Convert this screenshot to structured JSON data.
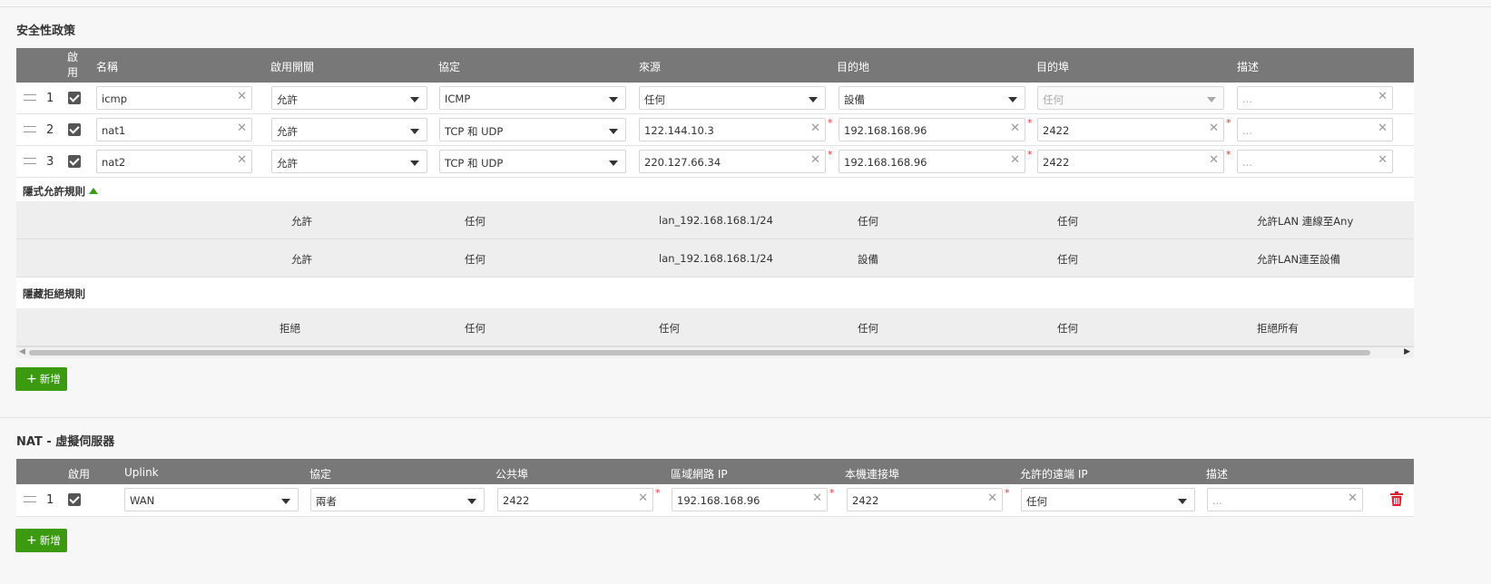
{
  "security": {
    "title": "安全性政策",
    "headers": {
      "enable": "啟用",
      "name": "名稱",
      "policy": "啟用開關",
      "protocol": "協定",
      "source": "來源",
      "destination": "目的地",
      "dest_port": "目的埠",
      "description": "描述"
    },
    "rows": [
      {
        "num": "1",
        "name": "icmp",
        "policy": "允許",
        "protocol": "ICMP",
        "source": "任何",
        "destination": "設備",
        "dest_port": "任何",
        "description": "..."
      },
      {
        "num": "2",
        "name": "nat1",
        "policy": "允許",
        "protocol": "TCP 和 UDP",
        "source": "122.144.10.3",
        "destination": "192.168.168.96",
        "dest_port": "2422",
        "description": "..."
      },
      {
        "num": "3",
        "name": "nat2",
        "policy": "允許",
        "protocol": "TCP 和 UDP",
        "source": "220.127.66.34",
        "destination": "192.168.168.96",
        "dest_port": "2422",
        "description": "..."
      }
    ],
    "implicit_allow": {
      "title": "隱式允許規則",
      "rows": [
        {
          "policy": "允許",
          "protocol": "任何",
          "source": "lan_192.168.168.1/24",
          "destination": "任何",
          "dest_port": "任何",
          "description": "允許LAN 連線至Any"
        },
        {
          "policy": "允許",
          "protocol": "任何",
          "source": "lan_192.168.168.1/24",
          "destination": "設備",
          "dest_port": "任何",
          "description": "允許LAN連至設備"
        }
      ]
    },
    "implicit_deny": {
      "title": "隱藏拒絕規則",
      "rows": [
        {
          "policy": "拒絕",
          "protocol": "任何",
          "source": "任何",
          "destination": "任何",
          "dest_port": "任何",
          "description": "拒絕所有"
        }
      ]
    },
    "add_label": "新增"
  },
  "nat": {
    "title": "NAT - 虛擬伺服器",
    "headers": {
      "enable": "啟用",
      "uplink": "Uplink",
      "protocol": "協定",
      "public_port": "公共埠",
      "lan_ip": "區域網路 IP",
      "local_port": "本機連接埠",
      "remote_ip": "允許的遠端 IP",
      "description": "描述"
    },
    "rows": [
      {
        "num": "1",
        "uplink": "WAN",
        "protocol": "兩者",
        "public_port": "2422",
        "lan_ip": "192.168.168.96",
        "local_port": "2422",
        "remote_ip": "任何",
        "description": "..."
      }
    ],
    "add_label": "新增"
  },
  "colors": {
    "header_bg": "#787878",
    "accent_green": "#3c9a11",
    "required_red": "#e53935",
    "delete_red": "#d9232e"
  }
}
